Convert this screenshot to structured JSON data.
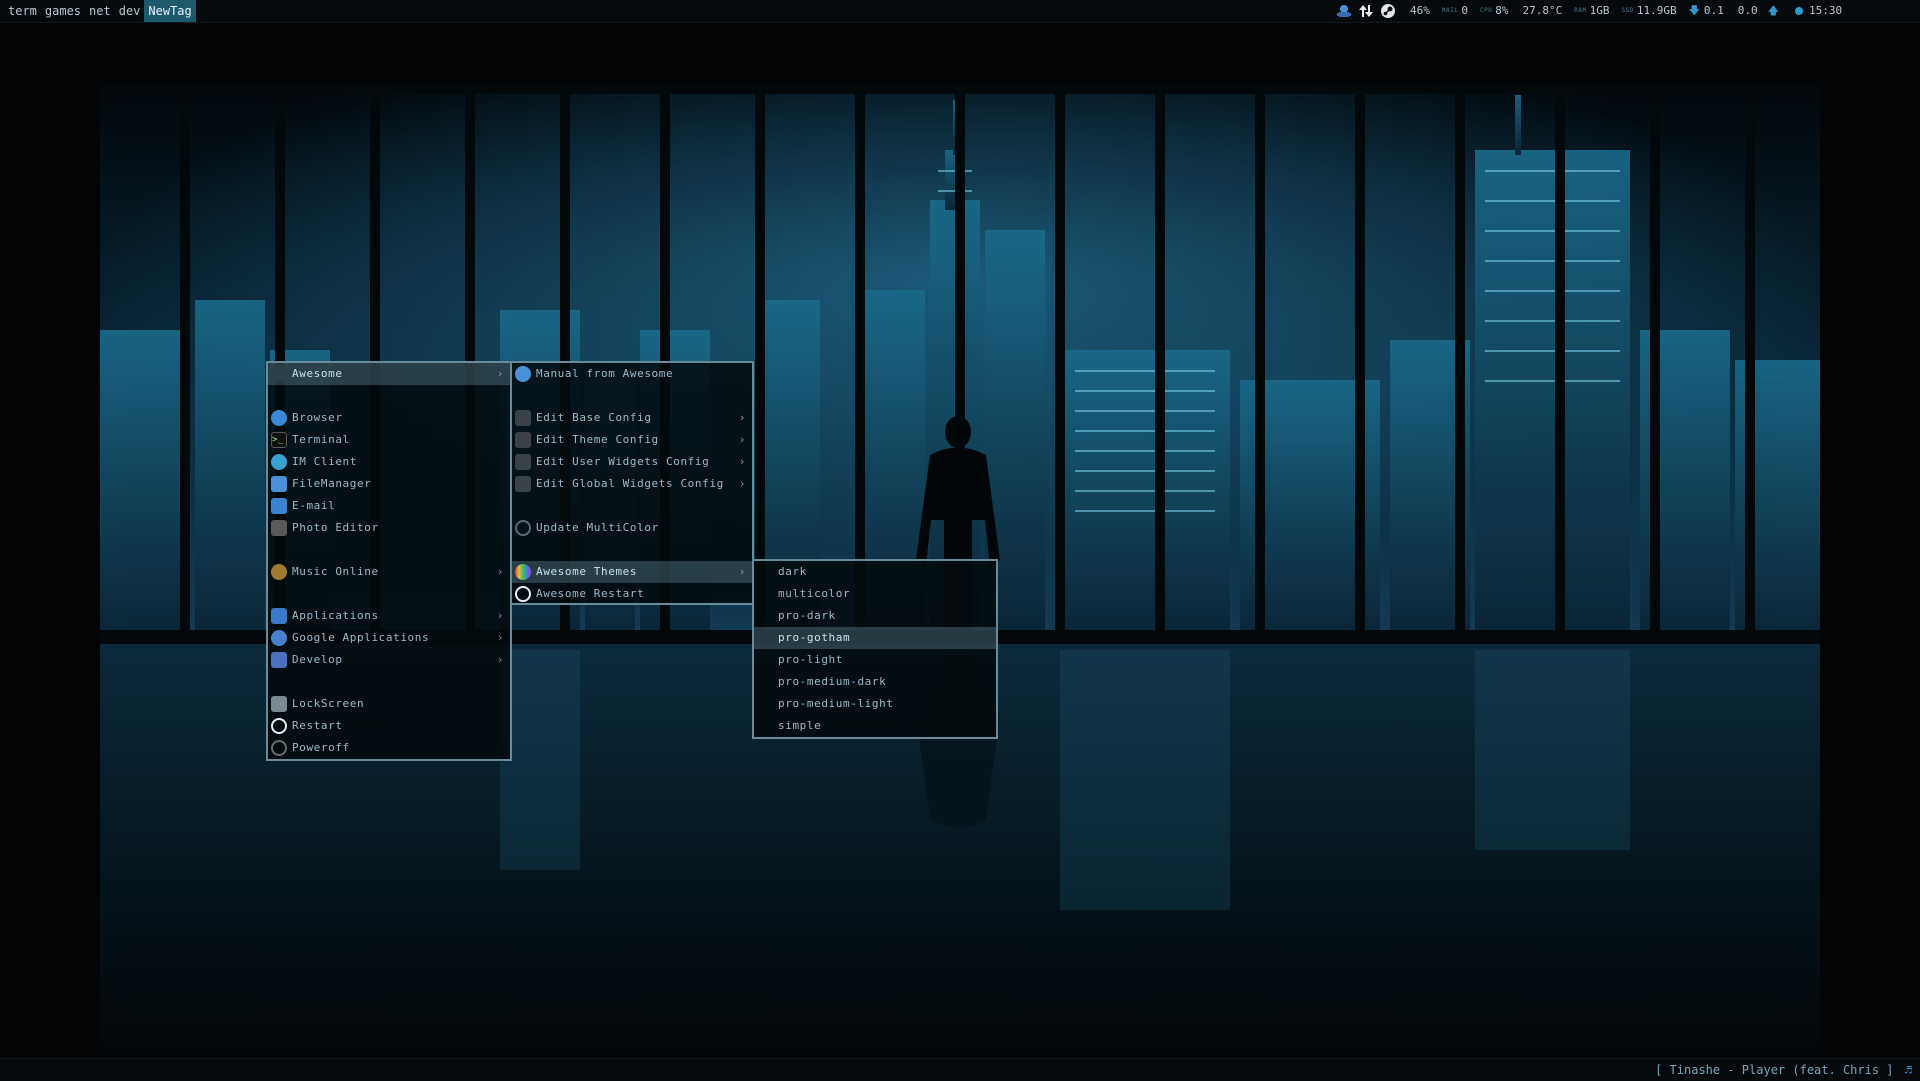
{
  "topbar": {
    "tags": [
      {
        "label": "term",
        "active": false
      },
      {
        "label": "games",
        "active": false
      },
      {
        "label": "net",
        "active": false
      },
      {
        "label": "dev",
        "active": false
      },
      {
        "label": "NewTag",
        "active": true
      }
    ],
    "tray_icons": [
      "network-robot-icon",
      "transfer-arrows-icon",
      "steam-icon"
    ],
    "widgets": {
      "volume": "46%",
      "mail_label": "MAIL",
      "mail": "0",
      "cpu_label": "CPU",
      "cpu": "8%",
      "temp": "27.8°C",
      "ram_label": "RAM",
      "ram": "1GB",
      "ssd_label": "SSD",
      "ssd": "11.9GB",
      "net_down": "0.1",
      "net_up": "0.0",
      "clock": "15:30"
    }
  },
  "menu_main": {
    "items": [
      {
        "label": "Awesome",
        "icon": "awesome-icon",
        "submenu": true,
        "selected": true
      },
      {
        "label": "Browser",
        "icon": "globe-icon",
        "submenu": false
      },
      {
        "label": "Terminal",
        "icon": "terminal-icon",
        "submenu": false
      },
      {
        "label": "IM Client",
        "icon": "chat-icon",
        "submenu": false
      },
      {
        "label": "FileManager",
        "icon": "folder-icon",
        "submenu": false
      },
      {
        "label": "E-mail",
        "icon": "mail-icon",
        "submenu": false
      },
      {
        "label": "Photo Editor",
        "icon": "photo-editor-icon",
        "submenu": false
      },
      {
        "label": "Music Online",
        "icon": "headphones-icon",
        "submenu": true
      },
      {
        "label": "Applications",
        "icon": "applications-icon",
        "submenu": true
      },
      {
        "label": "Google Applications",
        "icon": "google-icon",
        "submenu": true
      },
      {
        "label": "Develop",
        "icon": "develop-icon",
        "submenu": true
      },
      {
        "label": "LockScreen",
        "icon": "lock-icon",
        "submenu": false
      },
      {
        "label": "Restart",
        "icon": "restart-icon",
        "submenu": false
      },
      {
        "label": "Poweroff",
        "icon": "power-icon",
        "submenu": false
      }
    ]
  },
  "menu_awesome": {
    "items": [
      {
        "label": "Manual from Awesome",
        "icon": "help-icon",
        "submenu": false
      },
      {
        "label": "Edit Base Config",
        "icon": "edit-icon",
        "submenu": true
      },
      {
        "label": "Edit Theme Config",
        "icon": "edit-icon",
        "submenu": true
      },
      {
        "label": "Edit User Widgets Config",
        "icon": "edit-icon",
        "submenu": true
      },
      {
        "label": "Edit Global Widgets Config",
        "icon": "edit-icon",
        "submenu": true
      },
      {
        "label": "Update MultiColor",
        "icon": "refresh-icon",
        "submenu": false
      },
      {
        "label": "Awesome Themes",
        "icon": "color-palette-icon",
        "submenu": true,
        "selected": true
      },
      {
        "label": "Awesome Restart",
        "icon": "restart-icon",
        "submenu": false
      }
    ]
  },
  "menu_themes": {
    "items": [
      {
        "label": "dark"
      },
      {
        "label": "multicolor"
      },
      {
        "label": "pro-dark"
      },
      {
        "label": "pro-gotham",
        "selected": true
      },
      {
        "label": "pro-light"
      },
      {
        "label": "pro-medium-dark"
      },
      {
        "label": "pro-medium-light"
      },
      {
        "label": "simple"
      }
    ]
  },
  "bottombar": {
    "now_playing": "[  Tinashe - Player (feat. Chris ]",
    "player_icon": "music-player-icon"
  },
  "colors": {
    "accent": "#1e5a6e",
    "menu_border": "#6a8c98",
    "menu_text": "#9bb9c6",
    "icon_blue": "#2e9ad0"
  }
}
